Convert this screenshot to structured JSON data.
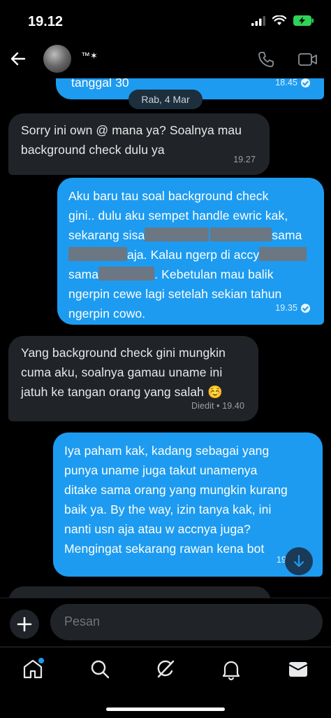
{
  "status_bar": {
    "time": "19.12"
  },
  "header": {
    "contact_name": "™✶"
  },
  "date_separator": "Rab, 4 Mar",
  "messages": [
    {
      "id": "m0",
      "direction": "sent",
      "text": "tanggal 30",
      "time": "18.45",
      "read": true
    },
    {
      "id": "m1",
      "direction": "received",
      "lines": [
        "Sorry ini own @ mana ya? Soalnya mau",
        "background check dulu ya"
      ],
      "time": "19.27"
    },
    {
      "id": "m2",
      "direction": "sent",
      "line1": "Aku baru tau soal background check",
      "line2": "gini.. dulu aku sempet handle ewric kak,",
      "line3a": "sekarang sisa",
      "line3b": "sama",
      "line4a": "aja. Kalau ngerp di accy",
      "line5a": "sama",
      "line5b": ". Kebetulan mau balik",
      "line6": "ngerpin cewe lagi setelah sekian tahun",
      "line7": "ngerpin cowo.",
      "time": "19.35",
      "read": true
    },
    {
      "id": "m3",
      "direction": "received",
      "lines": [
        "Yang background check gini mungkin",
        "cuma aku, soalnya gamau uname ini",
        "jatuh ke tangan orang yang salah ☺️"
      ],
      "time": "Diedit • 19.40"
    },
    {
      "id": "m4",
      "direction": "sent",
      "lines": [
        "Iya paham kak, kadang sebagai yang",
        "punya uname juga takut unamenya",
        "ditake sama orang yang mungkin kurang",
        "baik ya. By the way, izin tanya kak, ini",
        "nanti usn aja atau w accnya juga?",
        "Mengingat sekarang rawan kena bot"
      ],
      "time": "19"
    }
  ],
  "compose": {
    "placeholder": "Pesan"
  },
  "nav": {
    "items": [
      {
        "name": "home",
        "icon": "home-icon",
        "has_notification_dot": true
      },
      {
        "name": "search",
        "icon": "search-icon"
      },
      {
        "name": "grok",
        "icon": "grok-icon"
      },
      {
        "name": "notifications",
        "icon": "bell-icon"
      },
      {
        "name": "messages",
        "icon": "envelope-icon"
      }
    ]
  },
  "colors": {
    "accent": "#1d9bf0",
    "received_bubble": "#202327",
    "background": "#000000",
    "notification_dot": "#1d9bf0"
  }
}
